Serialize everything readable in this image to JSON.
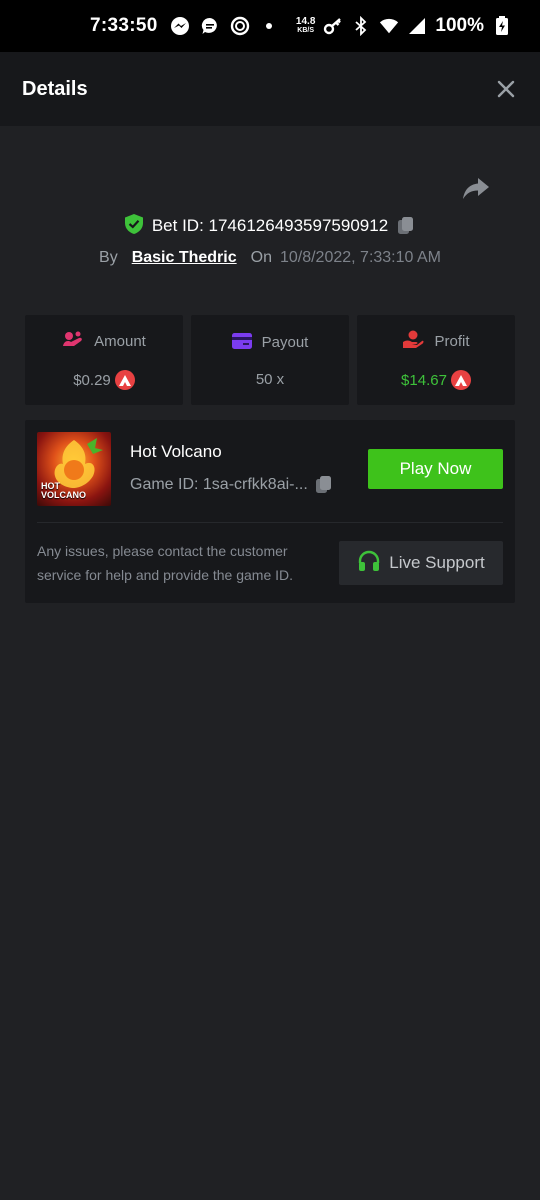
{
  "status_bar": {
    "time": "7:33:50",
    "net_speed_value": "14.8",
    "net_speed_unit": "KB/S",
    "battery": "100%"
  },
  "header": {
    "title": "Details"
  },
  "bet": {
    "id_text": "Bet ID: 1746126493597590912",
    "by_label": "By",
    "user": "Basic Thedric",
    "on_label": "On",
    "date": "10/8/2022, 7:33:10 AM"
  },
  "stats": {
    "amount": {
      "label": "Amount",
      "value": "$0.29"
    },
    "payout": {
      "label": "Payout",
      "value": "50 x"
    },
    "profit": {
      "label": "Profit",
      "value": "$14.67"
    }
  },
  "game": {
    "name": "Hot Volcano",
    "id_text": "Game ID: 1sa-crfkk8ai-...",
    "thumb_text_1": "HOT",
    "thumb_text_2": "VOLCANO",
    "play_label": "Play Now",
    "issue_text": "Any issues, please contact the customer service for help and provide the game ID.",
    "support_label": "Live Support"
  },
  "colors": {
    "background": "#202124",
    "card": "#17181b",
    "accent_green": "#3ec21b",
    "profit_green": "#3ec23a",
    "avax_red": "#e84142",
    "amount_pink": "#e0356f",
    "payout_purple": "#7b3cf0",
    "profit_red": "#e23a3a"
  }
}
